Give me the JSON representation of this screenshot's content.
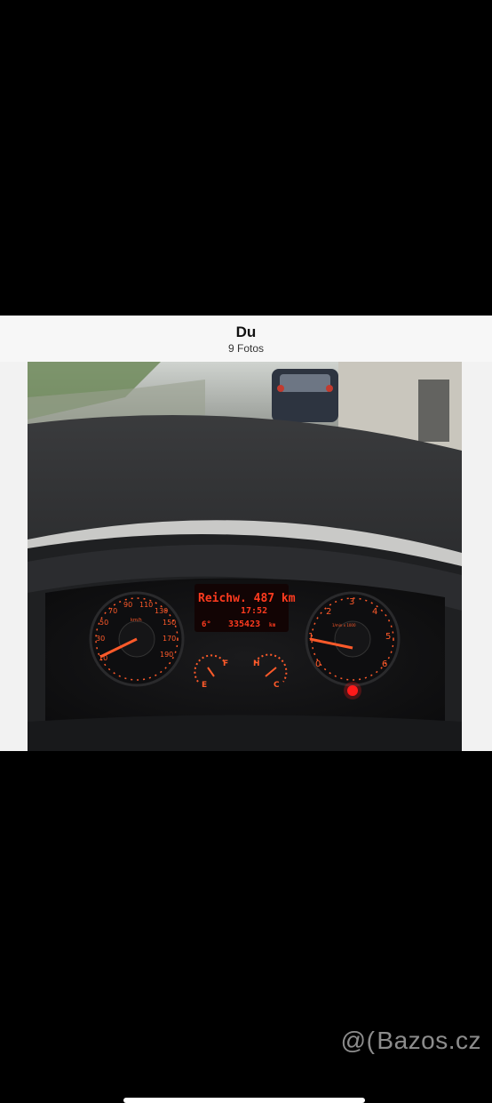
{
  "album": {
    "title": "Du",
    "subtitle": "9 Fotos"
  },
  "photo": {
    "lcd_line1": "Reichw. 487 km",
    "lcd_time": "17:52",
    "lcd_gear": "6°",
    "lcd_odometer": "335423",
    "lcd_unit": "km",
    "speedometer_ticks": [
      "10",
      "30",
      "50",
      "70",
      "90",
      "110",
      "130",
      "150",
      "170",
      "190"
    ],
    "speed_unit": "km/h",
    "tacho_ticks": [
      "0",
      "1",
      "2",
      "3",
      "4",
      "5",
      "6"
    ],
    "tacho_unit": "1/min x 1000",
    "fuel_labels": [
      "E",
      "F"
    ],
    "temp_labels": [
      "H",
      "C"
    ]
  },
  "watermark": {
    "logo": "@(",
    "text": "Bazos.cz"
  },
  "colors": {
    "gauge_orange": "#ff5a2a",
    "lcd_red": "#ff3b1f",
    "header_bg": "#f7f7f7",
    "warning_light": "#ff1a1a"
  }
}
